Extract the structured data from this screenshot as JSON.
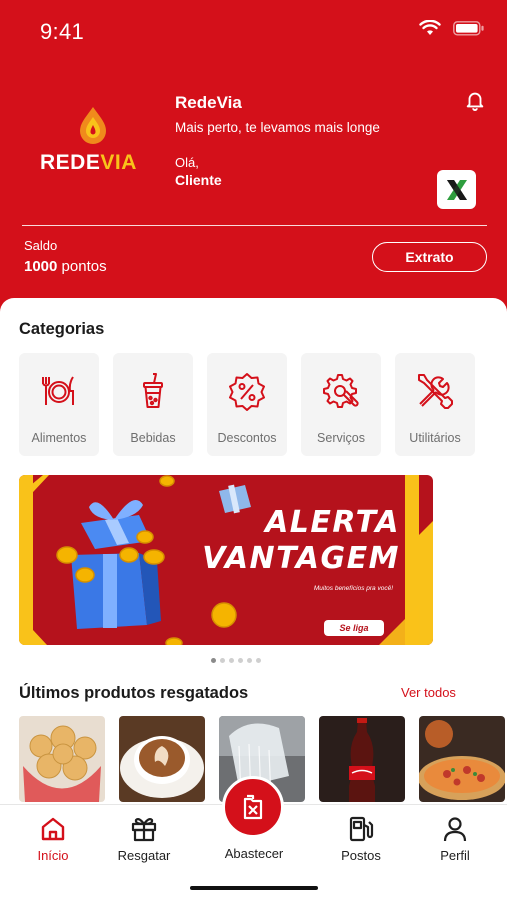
{
  "status_bar": {
    "time": "9:41"
  },
  "header": {
    "logo": {
      "text_main": "REDE",
      "text_accent": "VIA"
    },
    "title": "RedeVia",
    "tagline": "Mais perto, te levamos mais longe",
    "greeting": "Olá,",
    "user_name": "Cliente",
    "partner_logo": "X",
    "balance_label": "Saldo",
    "balance_amount": "1000",
    "balance_unit": "pontos",
    "statement_button": "Extrato"
  },
  "categories": {
    "title": "Categorias",
    "items": [
      {
        "label": "Alimentos",
        "icon": "fork-plate-knife-icon"
      },
      {
        "label": "Bebidas",
        "icon": "cup-straw-icon"
      },
      {
        "label": "Descontos",
        "icon": "percent-badge-icon"
      },
      {
        "label": "Serviços",
        "icon": "gear-wrench-icon"
      },
      {
        "label": "Utilitários",
        "icon": "tools-icon"
      }
    ]
  },
  "banner": {
    "title_line1": "ALERTA",
    "title_line2": "VANTAGEM",
    "subtitle": "Muitos benefícios pra você!",
    "cta": "Se liga",
    "active_slide": 1,
    "slide_count": 6
  },
  "recent": {
    "title": "Últimos produtos resgatados",
    "see_all": "Ver todos",
    "items": [
      {
        "name": "pao-de-queijo"
      },
      {
        "name": "cappuccino"
      },
      {
        "name": "car-wash"
      },
      {
        "name": "coca-cola"
      },
      {
        "name": "pizza"
      }
    ]
  },
  "bottom_nav": {
    "items": [
      {
        "label": "Início",
        "icon": "home-icon",
        "active": true
      },
      {
        "label": "Resgatar",
        "icon": "gift-icon",
        "active": false
      },
      {
        "label": "Abastecer",
        "icon": "fuel-can-icon",
        "active": false
      },
      {
        "label": "Postos",
        "icon": "fuel-station-icon",
        "active": false
      },
      {
        "label": "Perfil",
        "icon": "user-icon",
        "active": false
      }
    ]
  },
  "colors": {
    "primary": "#d4101a",
    "accent": "#f9c21a",
    "card_bg": "#f4f4f4"
  }
}
